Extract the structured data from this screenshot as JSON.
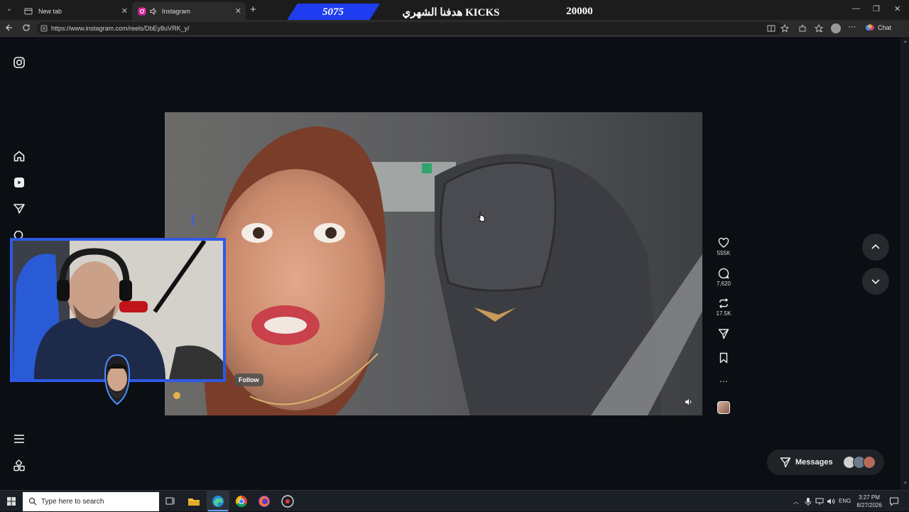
{
  "browser": {
    "tabs": [
      {
        "label": "New tab",
        "active": false
      },
      {
        "label": "Instagram",
        "active": true
      }
    ],
    "url": "https://www.instagram.com/reels/DbEy8uVRK_y/",
    "chat_label": "Chat"
  },
  "overlay": {
    "left_value": "5075",
    "title": "هدفنا الشهري KICKS",
    "right_value": "20000"
  },
  "reel": {
    "actions": [
      {
        "icon": "heart-icon",
        "count": "555K"
      },
      {
        "icon": "comment-icon",
        "count": "7,620"
      },
      {
        "icon": "repost-icon",
        "count": "17.5K"
      },
      {
        "icon": "share-icon",
        "count": ""
      },
      {
        "icon": "save-icon",
        "count": ""
      },
      {
        "icon": "more-icon",
        "count": ""
      }
    ],
    "follow_label": "Follow"
  },
  "messages": {
    "label": "Messages"
  },
  "taskbar": {
    "search_placeholder": "Type here to search",
    "language": "ENG",
    "time": "3:27 PM",
    "date": "8/27/2026"
  },
  "colors": {
    "background": "#0b0f13",
    "overlay_blue": "#1e3df0",
    "webcam_border": "#2f5ae6"
  }
}
